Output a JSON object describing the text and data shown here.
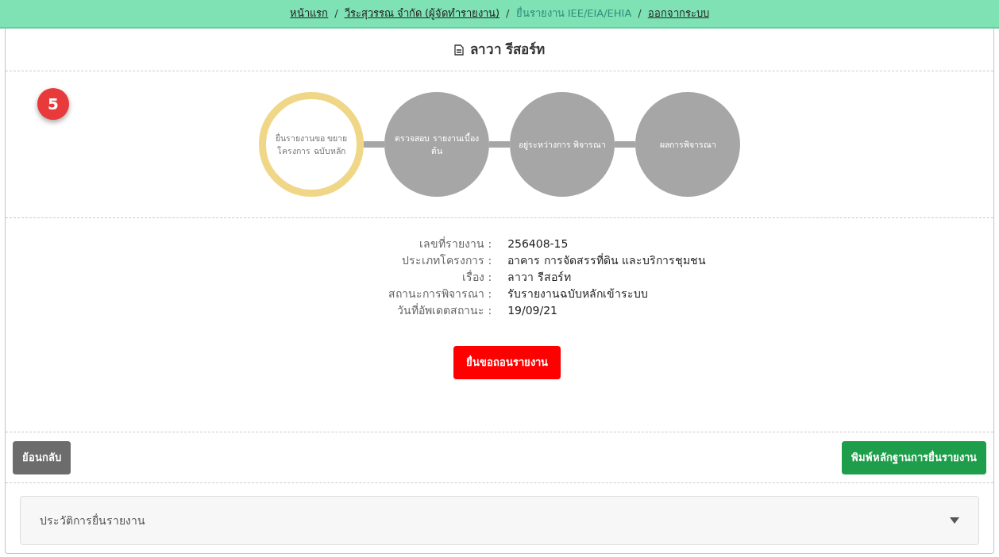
{
  "breadcrumb": [
    {
      "label": "หน้าแรก",
      "selected": false
    },
    {
      "label": "วีระสุวรรณ จำกัด (ผู้จัดทำรายงาน)",
      "selected": false
    },
    {
      "label": "ยื่นรายงาน IEE/EIA/EHIA",
      "selected": true
    },
    {
      "label": "ออกจากระบบ",
      "selected": false
    }
  ],
  "breadcrumb_separator": "/",
  "title": "ลาวา รีสอร์ท",
  "step_badge": "5",
  "steps": [
    {
      "label": "ยื่นรายงานขอ ขยายโครงการ ฉบับหลัก",
      "selected": true
    },
    {
      "label": "ตรวจสอบ รายงานเบื้องต้น",
      "selected": false
    },
    {
      "label": "อยู่ระหว่างการ พิจารณา",
      "selected": false
    },
    {
      "label": "ผลการพิจารณา",
      "selected": false
    }
  ],
  "details": [
    {
      "label": "เลขที่รายงาน :",
      "value": "256408-15"
    },
    {
      "label": "ประเภทโครงการ :",
      "value": "อาคาร การจัดสรรที่ดิน และบริการชุมชน"
    },
    {
      "label": "เรื่อง :",
      "value": "ลาวา รีสอร์ท"
    },
    {
      "label": "สถานะการพิจารณา :",
      "value": "รับรายงานฉบับหลักเข้าระบบ"
    },
    {
      "label": "วันที่อัพเดตสถานะ :",
      "value": "19/09/21"
    }
  ],
  "withdraw_button": "ยื่นขอถอนรายงาน",
  "back_button": "ย้อนกลับ",
  "print_button": "พิมพ์หลักฐานการยื่นรายงาน",
  "history": {
    "label": "ประวัติการยื่นรายงาน",
    "expanded": false
  }
}
